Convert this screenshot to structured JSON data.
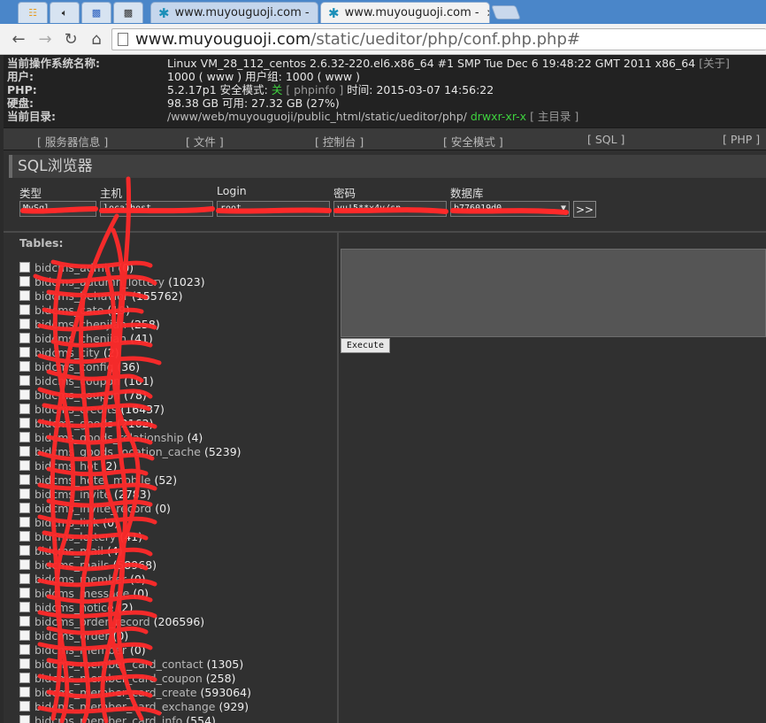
{
  "browser": {
    "tabs": [
      {
        "title": "www.muyouguoji.com -",
        "active": false
      },
      {
        "title": "www.muyouguoji.com -",
        "active": true
      }
    ],
    "url_host": "www.muyouguoji.com",
    "url_path": "/static/ueditor/php/conf.php.php#"
  },
  "info": {
    "rows": [
      {
        "label": "当前操作系统名称:",
        "value": "Linux VM_28_112_centos 2.6.32-220.el6.x86_64 #1 SMP Tue Dec 6 19:48:22 GMT 2011 x86_64",
        "extra": "[关于]"
      },
      {
        "label": "用户:",
        "value": "1000 ( www ) 用户组: 1000 ( www )"
      },
      {
        "label": "PHP:",
        "value": "5.2.17p1 安全模式:",
        "safe_mode": "关",
        "phpinfo": "[ phpinfo ]",
        "time_label": "时间:",
        "time": "2015-03-07 14:56:22"
      },
      {
        "label": "硬盘:",
        "value": "98.38 GB 可用: 27.32 GB (27%)"
      },
      {
        "label": "当前目录:",
        "value": "/www/web/muyouguoji/public_html/static/ueditor/php/",
        "perm": "drwxr-xr-x",
        "home": "[ 主目录 ]"
      }
    ]
  },
  "menu": [
    "[ 服务器信息 ]",
    "[ 文件 ]",
    "[ 控制台 ]",
    "[ 安全模式 ]",
    "[ SQL ]",
    "[ PHP ]"
  ],
  "section_title": "SQL浏览器",
  "form": {
    "type_label": "类型",
    "host_label": "主机",
    "login_label": "Login",
    "password_label": "密码",
    "db_label": "数据库",
    "type_value": "MySql",
    "host_value": "localhost",
    "login_value": "root",
    "password_value": "yu!5**x4v/sn",
    "db_value": "b776019d0",
    "go_label": ">>"
  },
  "tables_label": "Tables:",
  "tables": [
    {
      "name": "bidcms_admin",
      "count": "(0)"
    },
    {
      "name": "bidcms_autumn_lottery",
      "count": "(1023)"
    },
    {
      "name": "bidcms_behavior",
      "count": "(155762)"
    },
    {
      "name": "bidcms_cate",
      "count": "(19)"
    },
    {
      "name": "bidcms_chenjian",
      "count": "(258)"
    },
    {
      "name": "bidcms_chenjian",
      "count": "(41)"
    },
    {
      "name": "bidcms_city",
      "count": "(2)"
    },
    {
      "name": "bidcms_config",
      "count": "(36)"
    },
    {
      "name": "bidcms_coupon",
      "count": "(101)"
    },
    {
      "name": "bidcms_coupon",
      "count": "(78)"
    },
    {
      "name": "bidcms_credits",
      "count": "(16437)"
    },
    {
      "name": "bidcms_goods",
      "count": "(2162)"
    },
    {
      "name": "bidcms_goods_relationship",
      "count": "(4)"
    },
    {
      "name": "bidcms_goods_location_cache",
      "count": "(5239)"
    },
    {
      "name": "bidcms_hot",
      "count": "(2)"
    },
    {
      "name": "bidcms_hotel_mobile",
      "count": "(52)"
    },
    {
      "name": "bidcms_invite",
      "count": "(2783)"
    },
    {
      "name": "bidcms_invite_record",
      "count": "(0)"
    },
    {
      "name": "bidcms_link",
      "count": "(0)"
    },
    {
      "name": "bidcms_lottery",
      "count": "(41)"
    },
    {
      "name": "bidcms_mail",
      "count": "(4)"
    },
    {
      "name": "bidcms_mails",
      "count": "(58968)"
    },
    {
      "name": "bidcms_member",
      "count": "(0)"
    },
    {
      "name": "bidcms_message",
      "count": "(0)"
    },
    {
      "name": "bidcms_notice",
      "count": "(2)"
    },
    {
      "name": "bidcms_order_record",
      "count": "(206596)"
    },
    {
      "name": "bidcms_order",
      "count": "(0)"
    },
    {
      "name": "bidcms_member",
      "count": "(0)"
    },
    {
      "name": "bidcms_member_card_contact",
      "count": "(1305)"
    },
    {
      "name": "bidcms_member_card_coupon",
      "count": "(258)"
    },
    {
      "name": "bidcms_member_card_create",
      "count": "(593064)"
    },
    {
      "name": "bidcms_member_card_exchange",
      "count": "(929)"
    },
    {
      "name": "bidcms_member_card_info",
      "count": "(554)"
    }
  ],
  "execute_label": "Execute",
  "colors": {
    "accent_green": "#3ed13e",
    "scribble_red": "#ff2a2a",
    "tab_blue": "#4a86c9"
  }
}
